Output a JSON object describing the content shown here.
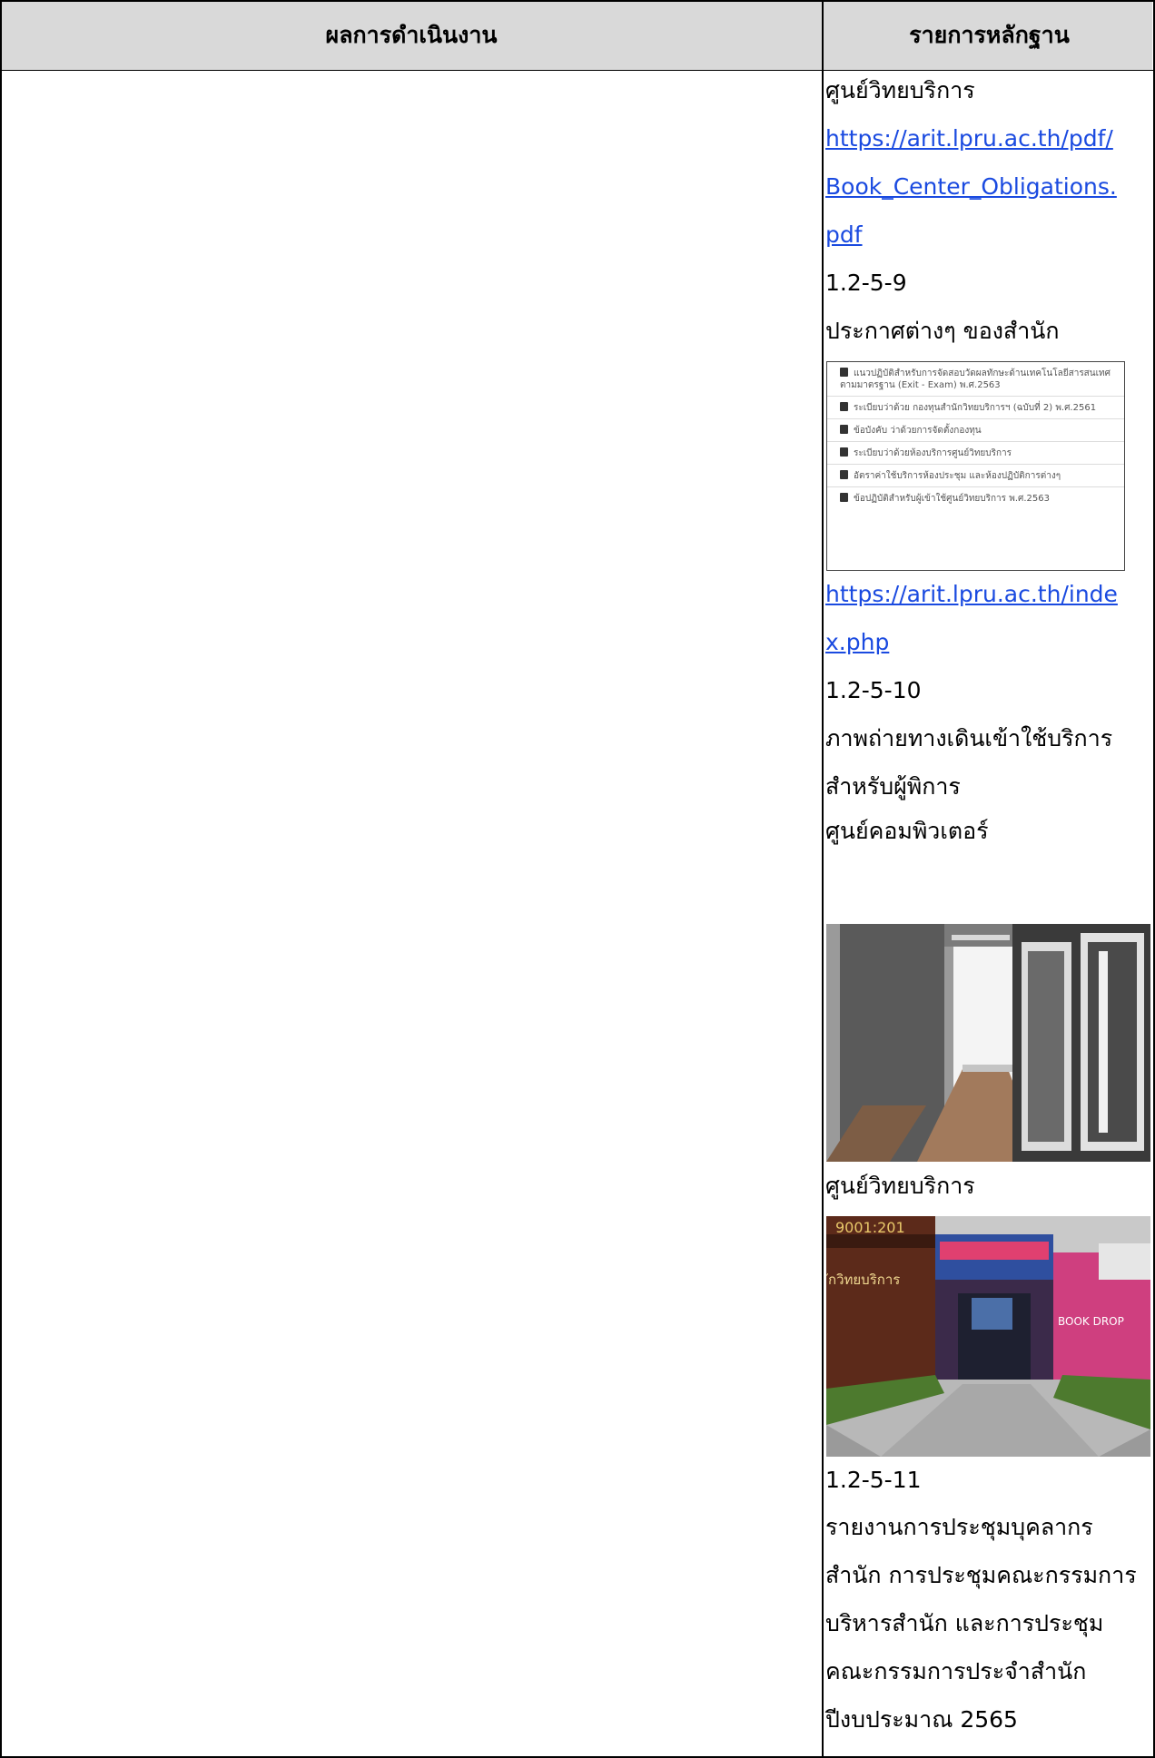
{
  "table": {
    "header_left": "ผลการดำเนินงาน",
    "header_right": "รายการหลักฐาน"
  },
  "evidence": {
    "line1": "ศูนย์วิทยบริการ",
    "link1_part1": "https://arit.lpru.ac.th/pdf/",
    "link1_part2": "Book_Center_Obligations.",
    "link1_part3": "pdf",
    "code1": "1.2-5-9",
    "notices_title": "ประกาศต่างๆ ของสำนัก",
    "notice_items": [
      "แนวปฏิบัติสำหรับการจัดสอบวัดผลทักษะด้านเทคโนโลยีสารสนเทศตามมาตรฐาน (Exit - Exam) พ.ศ.2563",
      "ระเบียบว่าด้วย กองทุนสำนักวิทยบริการฯ (ฉบับที่ 2) พ.ศ.2561",
      "ข้อบังคับ ว่าด้วยการจัดตั้งกองทุน",
      "ระเบียบว่าด้วยห้องบริการศูนย์วิทยบริการ",
      "อัตราค่าใช้บริการห้องประชุม และห้องปฏิบัติการต่างๆ",
      "ข้อปฏิบัติสำหรับผู้เข้าใช้ศูนย์วิทยบริการ พ.ศ.2563"
    ],
    "link2_part1": "https://arit.lpru.ac.th/inde",
    "link2_part2": "x.php",
    "code2": "1.2-5-10",
    "photo_desc1": "ภาพถ่ายทางเดินเข้าใช้บริการ",
    "photo_desc2": "สำหรับผู้พิการ",
    "photo1_caption": "ศูนย์คอมพิวเตอร์",
    "photo2_caption": "ศูนย์วิทยบริการ",
    "photo2_sign1": "9001:201",
    "photo2_sign2": "ักวิทยบริการ",
    "photo2_sign3": "BOOK DROP",
    "code3": "1.2-5-11",
    "report_lines": [
      "รายงานการประชุมบุคลากร",
      "สำนัก การประชุมคณะกรรมการ",
      "บริหารสำนัก และการประชุม",
      "คณะกรรมการประจำสำนัก",
      "ปีงบประมาณ 2565"
    ]
  }
}
